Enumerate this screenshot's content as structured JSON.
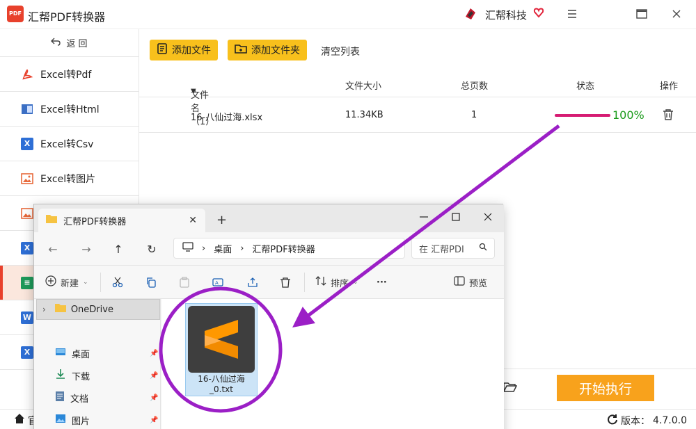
{
  "app": {
    "title": "汇帮PDF转换器",
    "logo_text": "PDF",
    "brand": "汇帮科技"
  },
  "sidebar": {
    "back_label": "返 回",
    "items": [
      {
        "label": "Excel转Pdf",
        "icon": "pdf-icon"
      },
      {
        "label": "Excel转Html",
        "icon": "html-icon"
      },
      {
        "label": "Excel转Csv",
        "icon": "csv-icon"
      },
      {
        "label": "Excel转图片",
        "icon": "image-icon"
      },
      {
        "label": "",
        "icon": "image-icon"
      },
      {
        "label": "",
        "icon": "excel-icon"
      },
      {
        "label": "",
        "icon": "txt-icon"
      },
      {
        "label": "",
        "icon": "word-icon"
      },
      {
        "label": "",
        "icon": "excel-icon"
      }
    ]
  },
  "toolbar": {
    "add_file": "添加文件",
    "add_folder": "添加文件夹",
    "clear_list": "清空列表"
  },
  "table": {
    "headers": {
      "name": "文件名（1）",
      "size": "文件大小",
      "pages": "总页数",
      "status": "状态",
      "action": "操作"
    },
    "rows": [
      {
        "name": "16-八仙过海.xlsx",
        "size": "11.34KB",
        "pages": "1",
        "progress_pct": 100,
        "status_text": "100%"
      }
    ]
  },
  "bottom": {
    "start_button": "开始执行",
    "home_label": "官",
    "version_label": "版本：",
    "version_number": "4.7.0.0"
  },
  "explorer": {
    "tab_title": "汇帮PDF转换器",
    "address": {
      "segments": [
        "桌面",
        "汇帮PDF转换器"
      ]
    },
    "search_placeholder": "在 汇帮PDI",
    "commands": {
      "new": "新建",
      "sort": "排序",
      "more": "···",
      "preview": "预览"
    },
    "nav": {
      "onedrive": "OneDrive",
      "quick_access": [
        {
          "label": "桌面",
          "icon": "desktop-icon"
        },
        {
          "label": "下载",
          "icon": "download-icon"
        },
        {
          "label": "文档",
          "icon": "document-icon"
        },
        {
          "label": "图片",
          "icon": "picture-icon"
        }
      ]
    },
    "files": [
      {
        "name_line1": "16-八仙过海",
        "name_line2": "_0.txt",
        "icon": "sublime-text-icon"
      }
    ]
  },
  "colors": {
    "accent_yellow": "#f8c01c",
    "start_orange": "#f8a21c",
    "progress_pink": "#d61c73",
    "success_green": "#1a9a1a",
    "annotation_purple": "#9b1fc6",
    "active_red": "#e8412c"
  }
}
